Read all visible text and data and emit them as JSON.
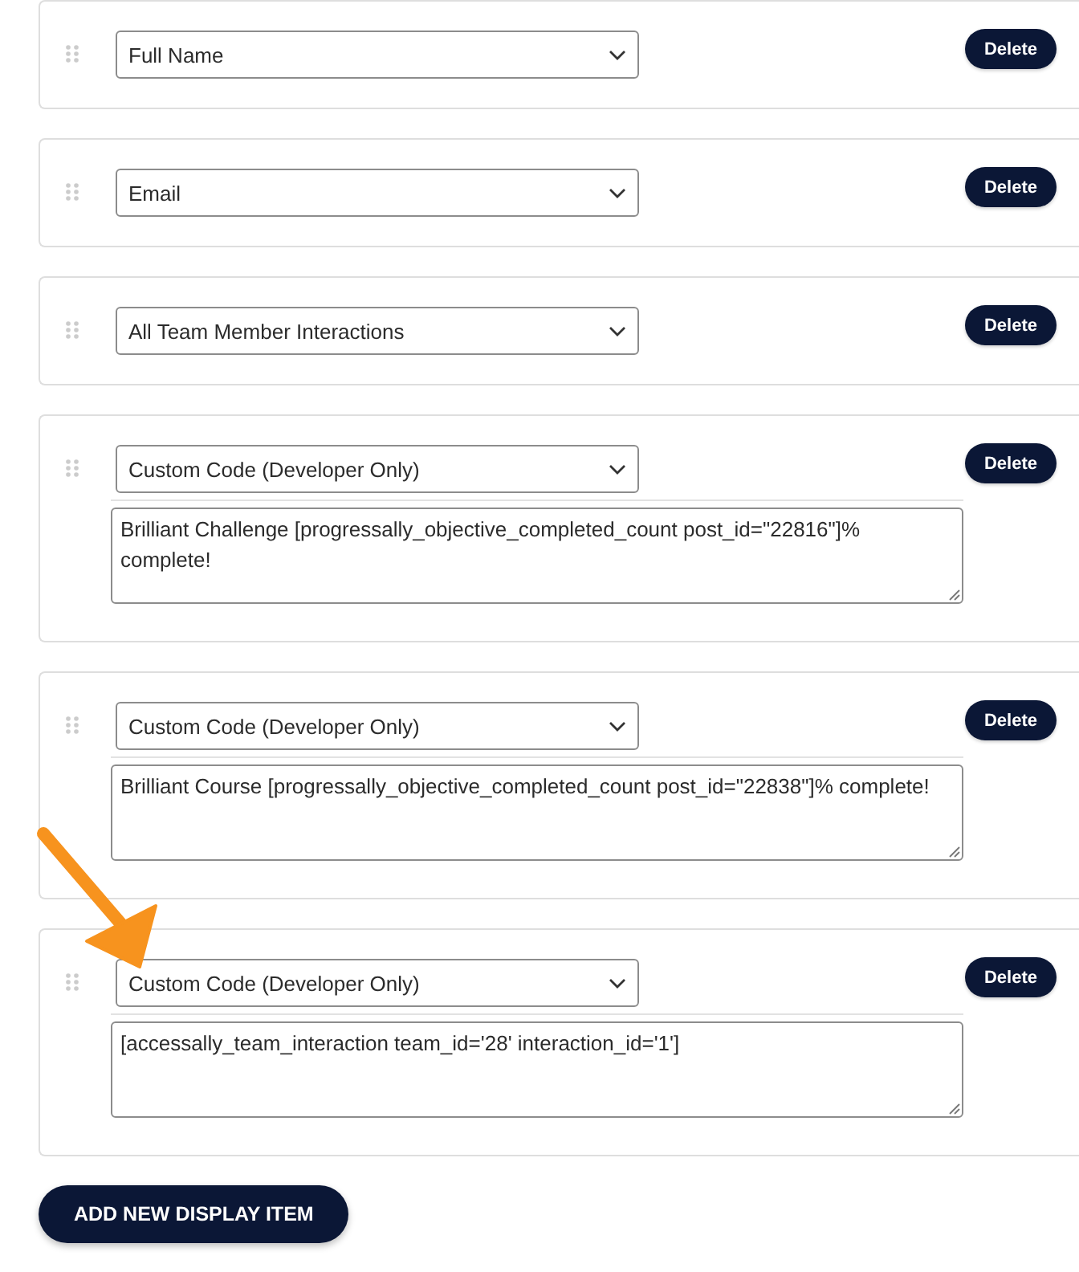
{
  "display_items": [
    {
      "kind": "select",
      "field": "Full Name",
      "delete_label": "Delete",
      "highlighted": false
    },
    {
      "kind": "select",
      "field": "Email",
      "delete_label": "Delete",
      "highlighted": false
    },
    {
      "kind": "select",
      "field": "All Team Member Interactions",
      "delete_label": "Delete",
      "highlighted": false
    },
    {
      "kind": "select_with_code",
      "field": "Custom Code (Developer Only)",
      "code": "Brilliant Challenge [progressally_objective_completed_count post_id=\"22816\"]% complete!",
      "delete_label": "Delete",
      "highlighted": false
    },
    {
      "kind": "select_with_code",
      "field": "Custom Code (Developer Only)",
      "code": "Brilliant Course [progressally_objective_completed_count post_id=\"22838\"]% complete!",
      "delete_label": "Delete",
      "highlighted": false
    },
    {
      "kind": "select_with_code",
      "field": "Custom Code (Developer Only)",
      "code": "[accessally_team_interaction team_id='28' interaction_id='1']",
      "delete_label": "Delete",
      "highlighted": true
    }
  ],
  "add_button": "ADD NEW DISPLAY ITEM"
}
